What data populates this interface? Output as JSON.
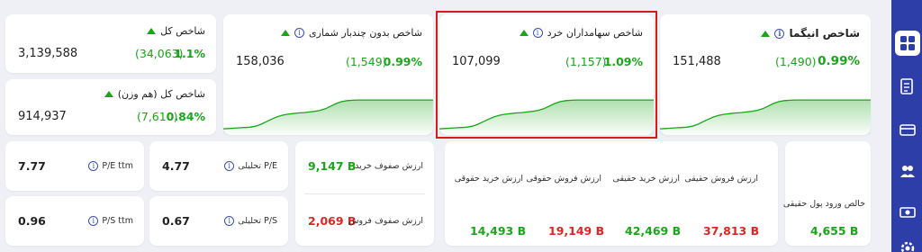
{
  "top_cards": {
    "total_index": {
      "title": "شاخص کل",
      "value": "3,139,588",
      "change": "(34,063)",
      "percent": "1.1%"
    },
    "total_index_eq": {
      "title": "شاخص کل (هم وزن)",
      "value": "914,937",
      "change": "(7,610)",
      "percent": "0.84%"
    },
    "index_free_float": {
      "title": "شاخص بدون چندبار شماری",
      "value": "158,036",
      "change": "(1,549)",
      "percent": "0.99%"
    },
    "index_small_shareholders": {
      "title": "شاخص سهامداران خرد",
      "value": "107,099",
      "change": "(1,157)",
      "percent": "1.09%"
    },
    "index_angima": {
      "title": "شاخص انیگما",
      "value": "151,488",
      "change": "(1,490)",
      "percent": "0.99%"
    }
  },
  "ratios": {
    "pe_ttm": {
      "label": "P/E ttm",
      "value": "7.77"
    },
    "pe_analytic": {
      "label": "P/E تحلیلی",
      "value": "4.77"
    },
    "ps_ttm": {
      "label": "P/S ttm",
      "value": "0.96"
    },
    "ps_analytic": {
      "label": "P/S تحلیلی",
      "value": "0.67"
    }
  },
  "queues": {
    "buy_queue": {
      "label": "ارزش صفوف خرید",
      "value": "9,147 B"
    },
    "sell_queue": {
      "label": "ارزش صفوف فروش",
      "value": "2,069 B"
    }
  },
  "money_flow": {
    "legal_buy": {
      "label": "ارزش خرید حقوقی",
      "value": "14,493 B"
    },
    "legal_sell": {
      "label": "ارزش فروش حقوقی",
      "value": "19,149 B"
    },
    "real_buy": {
      "label": "ارزش خرید حقیقی",
      "value": "42,469 B"
    },
    "real_sell": {
      "label": "ارزش فروش حقیقی",
      "value": "37,813 B"
    }
  },
  "net_flow": {
    "label": "خالص ورود پول حقیقی",
    "value": "4,655 B"
  },
  "icons": {
    "info": "i",
    "trend_up": "triangle-up",
    "sidebar": [
      "dashboard-icon",
      "document-icon",
      "card-icon",
      "group-icon",
      "money-icon",
      "settings-icon"
    ]
  },
  "colors": {
    "positive": "#1aa51a",
    "negative": "#e02424",
    "sidebar": "#2d3ea8",
    "highlight": "#d81a1a"
  },
  "sparkline_series": [
    0.08,
    0.09,
    0.1,
    0.11,
    0.12,
    0.13,
    0.16,
    0.22,
    0.3,
    0.38,
    0.45,
    0.5,
    0.53,
    0.55,
    0.57,
    0.58,
    0.6,
    0.62,
    0.65,
    0.7,
    0.78,
    0.86,
    0.92,
    0.95,
    0.96,
    0.97,
    0.97,
    0.97,
    0.97,
    0.97,
    0.97,
    0.97,
    0.97,
    0.97,
    0.97,
    0.97,
    0.97,
    0.97,
    0.97,
    0.97
  ]
}
